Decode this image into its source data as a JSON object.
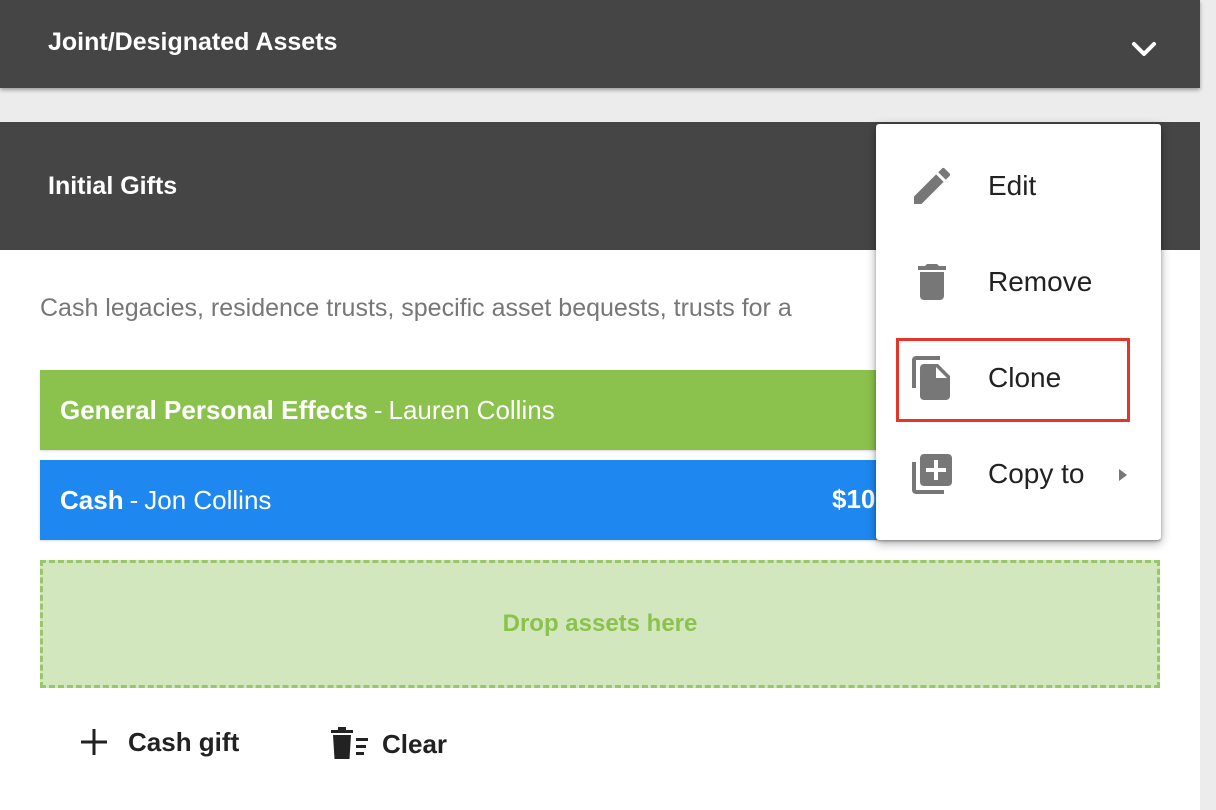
{
  "sections": {
    "joint": {
      "title": "Joint/Designated Assets",
      "toggle_icon": "chevron-down-icon"
    },
    "initial": {
      "title": "Initial Gifts",
      "description": "Cash legacies, residence trusts, specific asset bequests, trusts for a"
    }
  },
  "assets": [
    {
      "name": "General Personal Effects",
      "separator": "-",
      "beneficiary": "Lauren Collins",
      "color": "#8bc24e"
    },
    {
      "name": "Cash",
      "separator": "-",
      "beneficiary": "Jon Collins",
      "amount": "$10",
      "color": "#1e88f0"
    }
  ],
  "drop_zone": {
    "label": "Drop assets here"
  },
  "actions": {
    "cash_gift": {
      "label": "Cash gift",
      "icon": "plus-icon"
    },
    "clear": {
      "label": "Clear",
      "icon": "delete-sweep-icon"
    }
  },
  "context_menu": {
    "items": [
      {
        "label": "Edit",
        "icon": "pencil-icon"
      },
      {
        "label": "Remove",
        "icon": "trash-icon"
      },
      {
        "label": "Clone",
        "icon": "clone-icon",
        "highlighted": true
      },
      {
        "label": "Copy to",
        "icon": "copy-to-icon",
        "submenu": true
      }
    ]
  },
  "colors": {
    "header_bg": "#454545",
    "highlight": "#e53528",
    "drop_zone_bg": "#d2e7bd",
    "drop_zone_text": "#8bc24e"
  }
}
